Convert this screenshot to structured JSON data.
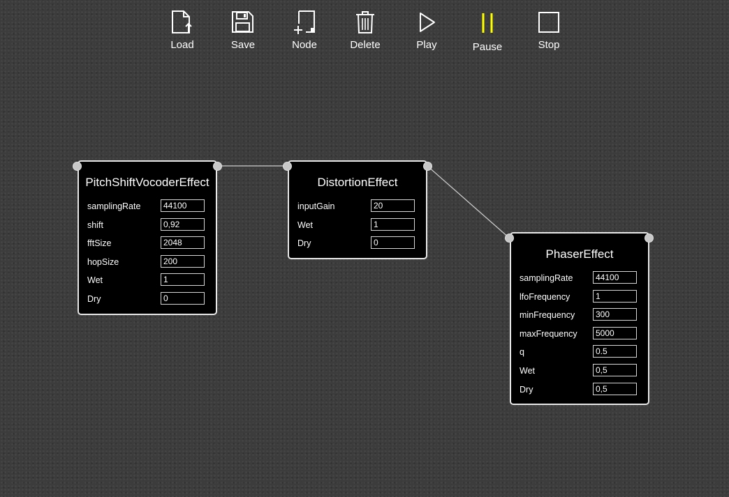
{
  "toolbar": {
    "load": {
      "label": "Load",
      "icon": "file-upload-icon"
    },
    "save": {
      "label": "Save",
      "icon": "floppy-disk-icon"
    },
    "node": {
      "label": "Node",
      "icon": "add-node-icon"
    },
    "delete": {
      "label": "Delete",
      "icon": "trash-icon"
    },
    "play": {
      "label": "Play",
      "icon": "play-icon"
    },
    "pause": {
      "label": "Pause",
      "icon": "pause-icon",
      "color": "#ffff00"
    },
    "stop": {
      "label": "Stop",
      "icon": "stop-icon"
    }
  },
  "nodes": {
    "pitch": {
      "title": "PitchShiftVocoderEffect",
      "params": [
        {
          "label": "samplingRate",
          "value": "44100"
        },
        {
          "label": "shift",
          "value": "0,92"
        },
        {
          "label": "fftSize",
          "value": "2048"
        },
        {
          "label": "hopSize",
          "value": "200"
        },
        {
          "label": "Wet",
          "value": "1"
        },
        {
          "label": "Dry",
          "value": "0"
        }
      ]
    },
    "distortion": {
      "title": "DistortionEffect",
      "params": [
        {
          "label": "inputGain",
          "value": "20"
        },
        {
          "label": "Wet",
          "value": "1"
        },
        {
          "label": "Dry",
          "value": "0"
        }
      ]
    },
    "phaser": {
      "title": "PhaserEffect",
      "params": [
        {
          "label": "samplingRate",
          "value": "44100"
        },
        {
          "label": "lfoFrequency",
          "value": "1"
        },
        {
          "label": "minFrequency",
          "value": "300"
        },
        {
          "label": "maxFrequency",
          "value": "5000"
        },
        {
          "label": "q",
          "value": "0.5"
        },
        {
          "label": "Wet",
          "value": "0,5"
        },
        {
          "label": "Dry",
          "value": "0,5"
        }
      ]
    }
  },
  "connections": [
    {
      "from": "pitch",
      "to": "distortion"
    },
    {
      "from": "distortion",
      "to": "phaser"
    }
  ],
  "colors": {
    "wire": "#cfcfcf",
    "port": "#c8c8c8",
    "node_border": "#e8e8e8",
    "accent": "#ffff00"
  }
}
